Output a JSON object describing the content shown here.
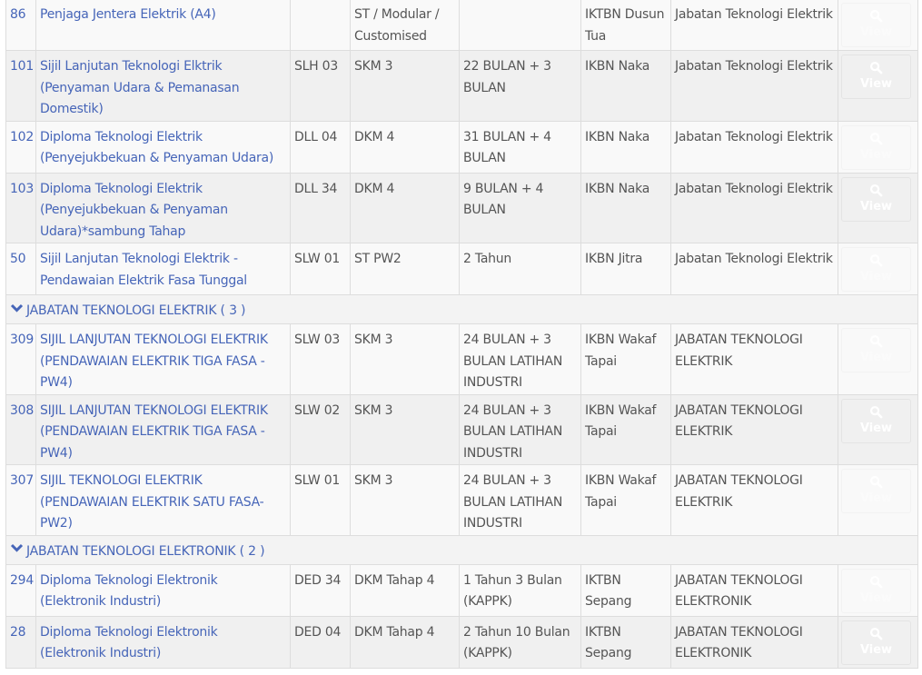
{
  "button_label": "View",
  "rows": [
    {
      "type": "row",
      "no": "86",
      "name": "Penjaga Jentera Elektrik (A4)",
      "code": "",
      "level": "ST / Modular / Customised",
      "duration": "",
      "institute": "IKTBN Dusun Tua",
      "department": "Jabatan Teknologi Elektrik",
      "button_faded": true
    },
    {
      "type": "row",
      "no": "101",
      "name": "Sijil Lanjutan Teknologi Elktrik (Penyaman Udara & Pemanasan Domestik)",
      "code": "SLH 03",
      "level": "SKM 3",
      "duration": "22 BULAN + 3 BULAN",
      "institute": "IKBN Naka",
      "department": "Jabatan Teknologi Elektrik",
      "button_faded": false
    },
    {
      "type": "row",
      "no": "102",
      "name": "Diploma Teknologi Elektrik (Penyejukbekuan & Penyaman Udara)",
      "code": "DLL 04",
      "level": "DKM 4",
      "duration": "31 BULAN + 4 BULAN",
      "institute": "IKBN Naka",
      "department": "Jabatan Teknologi Elektrik",
      "button_faded": true
    },
    {
      "type": "row",
      "no": "103",
      "name": "Diploma Teknologi Elektrik (Penyejukbekuan & Penyaman Udara)*sambung Tahap",
      "code": "DLL 34",
      "level": "DKM 4",
      "duration": "9 BULAN + 4 BULAN",
      "institute": "IKBN Naka",
      "department": "Jabatan Teknologi Elektrik",
      "button_faded": false
    },
    {
      "type": "row",
      "no": "50",
      "name": "Sijil Lanjutan Teknologi Elektrik - Pendawaian Elektrik Fasa Tunggal",
      "code": "SLW 01",
      "level": "ST PW2",
      "duration": "2 Tahun",
      "institute": "IKBN Jitra",
      "department": "Jabatan Teknologi Elektrik",
      "button_faded": true
    },
    {
      "type": "group",
      "label": "JABATAN TEKNOLOGI ELEKTRIK ( 3 )"
    },
    {
      "type": "row",
      "no": "309",
      "name": "SIJIL LANJUTAN TEKNOLOGI ELEKTRIK (PENDAWAIAN ELEKTRIK TIGA FASA - PW4)",
      "code": "SLW 03",
      "level": "SKM 3",
      "duration": "24 BULAN + 3 BULAN LATIHAN INDUSTRI",
      "institute": "IKBN Wakaf Tapai",
      "department": "JABATAN TEKNOLOGI ELEKTRIK",
      "button_faded": true
    },
    {
      "type": "row",
      "no": "308",
      "name": "SIJIL LANJUTAN TEKNOLOGI ELEKTRIK (PENDAWAIAN ELEKTRIK TIGA FASA - PW4)",
      "code": "SLW 02",
      "level": "SKM 3",
      "duration": "24 BULAN + 3 BULAN LATIHAN INDUSTRI",
      "institute": "IKBN Wakaf Tapai",
      "department": "JABATAN TEKNOLOGI ELEKTRIK",
      "button_faded": false
    },
    {
      "type": "row",
      "no": "307",
      "name": "SIJIL TEKNOLOGI ELEKTRIK (PENDAWAIAN ELEKTRIK SATU FASA-PW2)",
      "code": "SLW 01",
      "level": "SKM 3",
      "duration": "24 BULAN + 3 BULAN LATIHAN INDUSTRI",
      "institute": "IKBN Wakaf Tapai",
      "department": "JABATAN TEKNOLOGI ELEKTRIK",
      "button_faded": true
    },
    {
      "type": "group",
      "label": "JABATAN TEKNOLOGI ELEKTRONIK ( 2 )"
    },
    {
      "type": "row",
      "no": "294",
      "name": "Diploma Teknologi Elektronik (Elektronik Industri)",
      "code": "DED 34",
      "level": "DKM Tahap 4",
      "duration": "1 Tahun 3 Bulan (KAPPK)",
      "institute": "IKTBN Sepang",
      "department": "JABATAN TEKNOLOGI ELEKTRONIK",
      "button_faded": true
    },
    {
      "type": "row",
      "no": "28",
      "name": "Diploma Teknologi Elektronik (Elektronik Industri)",
      "code": "DED 04",
      "level": "DKM Tahap 4",
      "duration": "2 Tahun 10 Bulan (KAPPK)",
      "institute": "IKTBN Sepang",
      "department": "JABATAN TEKNOLOGI ELEKTRONIK",
      "button_faded": false
    }
  ]
}
